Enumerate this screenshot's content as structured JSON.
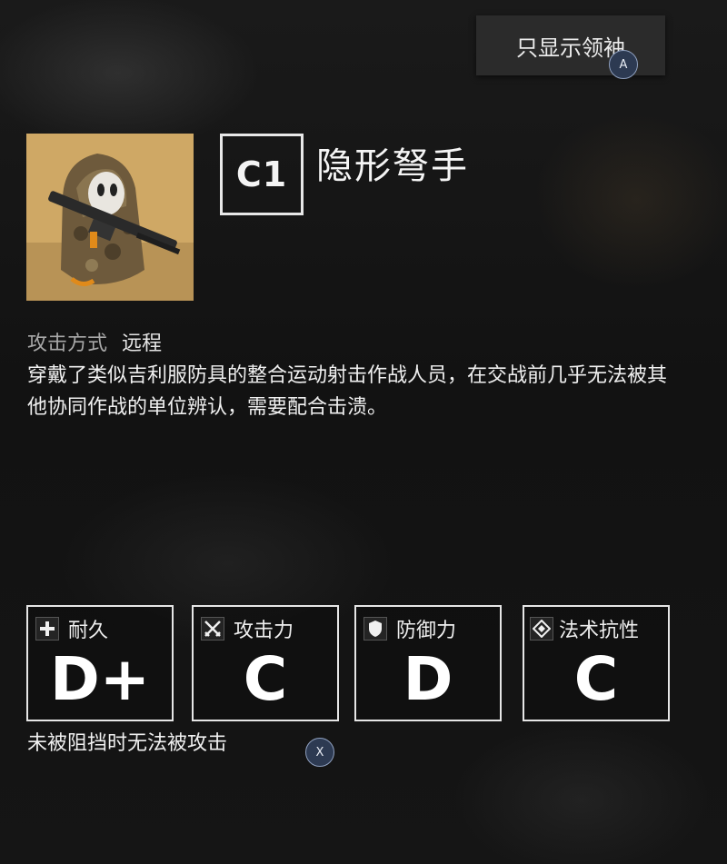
{
  "filter": {
    "label": "只显示领袖",
    "hint": "A"
  },
  "enemy": {
    "level": "C1",
    "name": "隐形弩手",
    "attack_type_label": "攻击方式",
    "attack_type_value": "远程",
    "description": "穿戴了类似吉利服防具的整合运动射击作战人员，在交战前几乎无法被其他协同作战的单位辨认，需要配合击溃。"
  },
  "stats": [
    {
      "label": "耐久",
      "grade": "D+",
      "icon": "plus-icon"
    },
    {
      "label": "攻击力",
      "grade": "C",
      "icon": "crossed-swords-icon"
    },
    {
      "label": "防御力",
      "grade": "D",
      "icon": "shield-icon"
    },
    {
      "label": "法术抗性",
      "grade": "C",
      "icon": "diamond-icon"
    }
  ],
  "trait": {
    "text": "未被阻挡时无法被攻击",
    "hint": "X"
  },
  "colors": {
    "accent": "#ffffff",
    "hint_badge": "#2d3a52"
  }
}
